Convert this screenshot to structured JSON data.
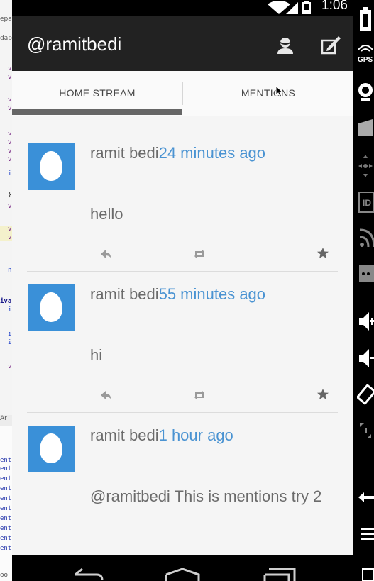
{
  "status_bar": {
    "time": "1:06",
    "icons": [
      "wifi-icon",
      "signal-icon",
      "battery-icon"
    ]
  },
  "ide_background": {
    "line_fragments": [
      "epa",
      "dap",
      "v",
      "v",
      "v",
      "v",
      "v",
      "v",
      "v",
      "v",
      "i",
      "}",
      "v",
      "v",
      "v",
      "n",
      "iva",
      "i",
      "i",
      "i",
      "v",
      "Ar",
      "ent",
      "ent",
      "ent",
      "ent",
      "ent",
      "ent",
      "ent",
      "ent",
      "ent",
      "ent",
      "oo"
    ]
  },
  "action_bar": {
    "title": "@ramitbedi",
    "profile_icon": "profile-icon",
    "compose_icon": "compose-icon"
  },
  "tabs": [
    {
      "label": "HOME STREAM",
      "selected": true
    },
    {
      "label": "MENTIONS",
      "selected": false
    }
  ],
  "tweets": [
    {
      "author": "ramit bedi",
      "time": "24 minutes ago",
      "text": "hello"
    },
    {
      "author": "ramit bedi",
      "time": "55 minutes ago",
      "text": "hi"
    },
    {
      "author": "ramit bedi",
      "time": "1 hour ago",
      "text": "@ramitbedi This is mentions try 2"
    }
  ],
  "tweet_actions": [
    "reply-icon",
    "retweet-icon",
    "favorite-icon"
  ],
  "emulator_controls": [
    "battery-side-icon",
    "gps-icon",
    "camera-icon",
    "video-icon",
    "dpad-icon",
    "id-icon",
    "network-icon",
    "sms-icon",
    "volume-up-icon",
    "volume-down-icon",
    "rotate-icon",
    "zoom-icon",
    "back-hw-icon",
    "menu-hw-icon"
  ],
  "nav_bar": [
    "back-nav-icon",
    "home-nav-icon",
    "recents-nav-icon"
  ],
  "colors": {
    "action_bar": "#222222",
    "accent_time": "#4a93d2",
    "avatar": "#3a90d8",
    "tab_indicator": "#666666"
  }
}
